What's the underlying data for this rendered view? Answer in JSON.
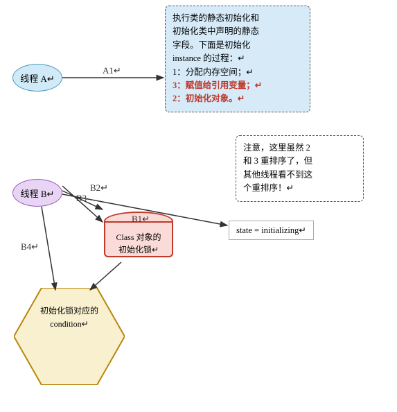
{
  "ellipse_a": {
    "label": "线程 A↵"
  },
  "ellipse_b": {
    "label": "线程 B↵"
  },
  "ellipse_b_inner": {
    "label": "线程 B↵"
  },
  "main_box": {
    "line1": "执行类的静态初始化和",
    "line2": "初始化类中声明的静态",
    "line3": "字段。下面是初始化",
    "line4": "instance 的过程：↵",
    "line5": "1：分配内存空间；↵",
    "line6_red": "3：赋值给引用变量；↵",
    "line7_red": "2：初始化对象。↵"
  },
  "note_box": {
    "line1": "注意，这里虽然 2",
    "line2": "和 3 重排序了，但",
    "line3": "其他线程看不到这",
    "line4": "个重排序！↵"
  },
  "state_box": {
    "text": "state = initializing↵"
  },
  "cylinder": {
    "label_line1": "Class 对象的",
    "label_line2": "初始化锁↵"
  },
  "hexagon": {
    "label_line1": "初始化锁对应的",
    "label_line2": "condition↵"
  },
  "arrows": {
    "a1_label": "A1↵",
    "b1_label": "B1↵",
    "b2_label": "B2↵",
    "b3_label": "B3",
    "b4_label": "B4↵"
  }
}
